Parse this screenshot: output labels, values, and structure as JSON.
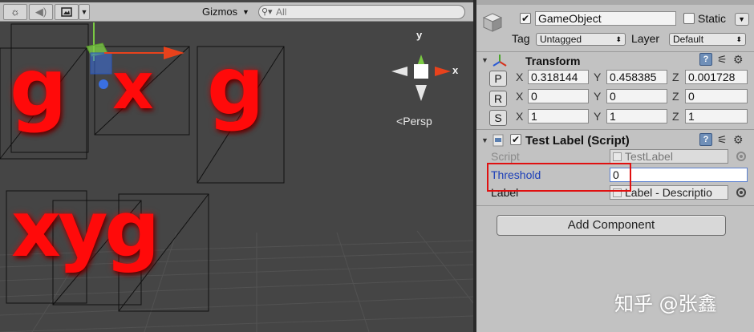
{
  "scene": {
    "toolbar": {
      "lighting_icon": "sun-icon",
      "audio_icon": "speaker-icon",
      "effects_icon": "image-icon",
      "gizmos_label": "Gizmos",
      "search_value": "All"
    },
    "glyph_labels": [
      "g",
      "x",
      "g",
      "xyg"
    ],
    "orientation": {
      "y_label": "y",
      "x_label": "x",
      "projection_label": "Persp"
    }
  },
  "inspector": {
    "gameobject": {
      "active_checked": true,
      "name": "GameObject",
      "static_label": "Static",
      "static_checked": false,
      "tag_label": "Tag",
      "tag_value": "Untagged",
      "layer_label": "Layer",
      "layer_value": "Default"
    },
    "transform": {
      "title": "Transform",
      "rows": [
        {
          "button": "P",
          "x_label": "X",
          "x": "0.318144",
          "y_label": "Y",
          "y": "0.458385",
          "z_label": "Z",
          "z": "0.001728"
        },
        {
          "button": "R",
          "x_label": "X",
          "x": "0",
          "y_label": "Y",
          "y": "0",
          "z_label": "Z",
          "z": "0"
        },
        {
          "button": "S",
          "x_label": "X",
          "x": "1",
          "y_label": "Y",
          "y": "1",
          "z_label": "Z",
          "z": "1"
        }
      ]
    },
    "test_label": {
      "enabled_checked": true,
      "title": "Test Label (Script)",
      "script_label": "Script",
      "script_value": "TestLabel",
      "threshold_label": "Threshold",
      "threshold_value": "0",
      "label_label": "Label",
      "label_value": "Label - Descriptio"
    },
    "add_component_label": "Add Component"
  },
  "watermark": "知乎 @张鑫",
  "colors": {
    "glyph_red": "#ff0a0a",
    "highlight_red": "#e01010",
    "threshold_label_blue": "#1c3fb8",
    "axis_y_green": "#7ac943",
    "axis_x_red": "#e8421c",
    "axis_z_blue": "#3a6fe0"
  }
}
